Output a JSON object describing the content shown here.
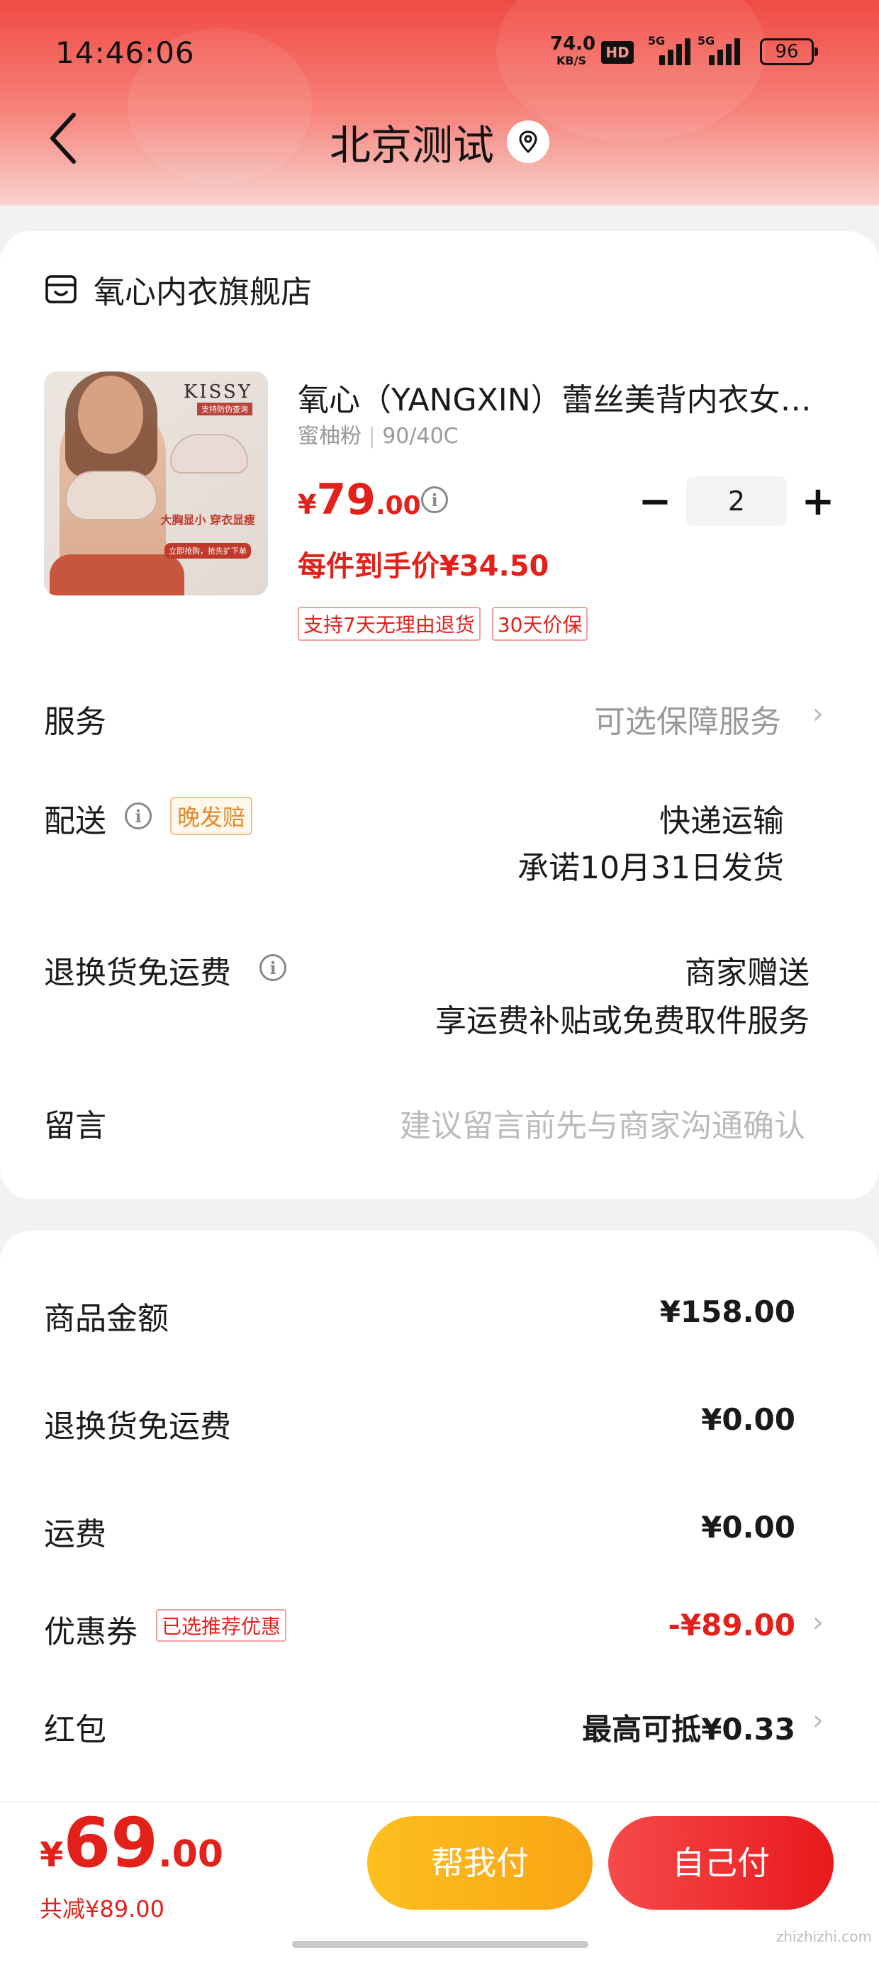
{
  "status_bar": {
    "time": "14:46:06",
    "net_speed_value": "74.0",
    "net_speed_unit": "KB/S",
    "hd_label": "HD",
    "sim1_label": "5G",
    "sim2_label": "5G",
    "battery": "96"
  },
  "header": {
    "title": "北京测试",
    "back_icon": "chevron-left-icon",
    "location_icon": "location-pin-icon",
    "gradient_top": "#f04a43",
    "gradient_bottom": "#f7d3cf"
  },
  "shop": {
    "icon": "shop-icon",
    "name": "氧心内衣旗舰店"
  },
  "product": {
    "title": "氧心（YANGXIN）蕾丝美背内衣女调整型收副乳聚拢文胸",
    "spec_color": "蜜柚粉",
    "spec_sep": "|",
    "spec_size": "90/40C",
    "price_currency": "¥",
    "price_int": "79",
    "price_dec": ".00",
    "per_price": "每件到手价¥34.50",
    "quantity": "2",
    "minus_label": "−",
    "plus_label": "+",
    "tags": [
      "支持7天无理由退货",
      "30天价保"
    ],
    "image": {
      "brand": "KISSY",
      "brand_sub": "支持防伪查询",
      "promo": "大胸显小 穿衣显瘦",
      "promo2": "立即抢购，抢先扩下单"
    }
  },
  "rows": {
    "service_label": "服务",
    "service_value": "可选保障服务",
    "delivery_label": "配送",
    "delivery_badge": "晚发赔",
    "delivery_value1": "快递运输",
    "delivery_value2": "承诺10月31日发货",
    "return_label": "退换货免运费",
    "return_value1": "商家赠送",
    "return_value2": "享运费补贴或免费取件服务",
    "message_label": "留言",
    "message_placeholder": "建议留言前先与商家沟通确认"
  },
  "summary": {
    "goods_label": "商品金额",
    "goods_value": "¥158.00",
    "return_fee_label": "退换货免运费",
    "return_fee_value": "¥0.00",
    "shipping_label": "运费",
    "shipping_value": "¥0.00",
    "coupon_label": "优惠券",
    "coupon_badge": "已选推荐优惠",
    "coupon_value": "-¥89.00",
    "redpacket_label": "红包",
    "redpacket_value": "最高可抵¥0.33"
  },
  "bottom": {
    "total_currency": "¥",
    "total_int": "69",
    "total_dec": ".00",
    "saved": "共减¥89.00",
    "help_pay": "帮我付",
    "self_pay": "自己付",
    "watermark": "zhizhizhi.com"
  },
  "colors": {
    "accent_red": "#e3211b",
    "help_button": "#fdbf1e",
    "self_button": "#f64a4a"
  }
}
